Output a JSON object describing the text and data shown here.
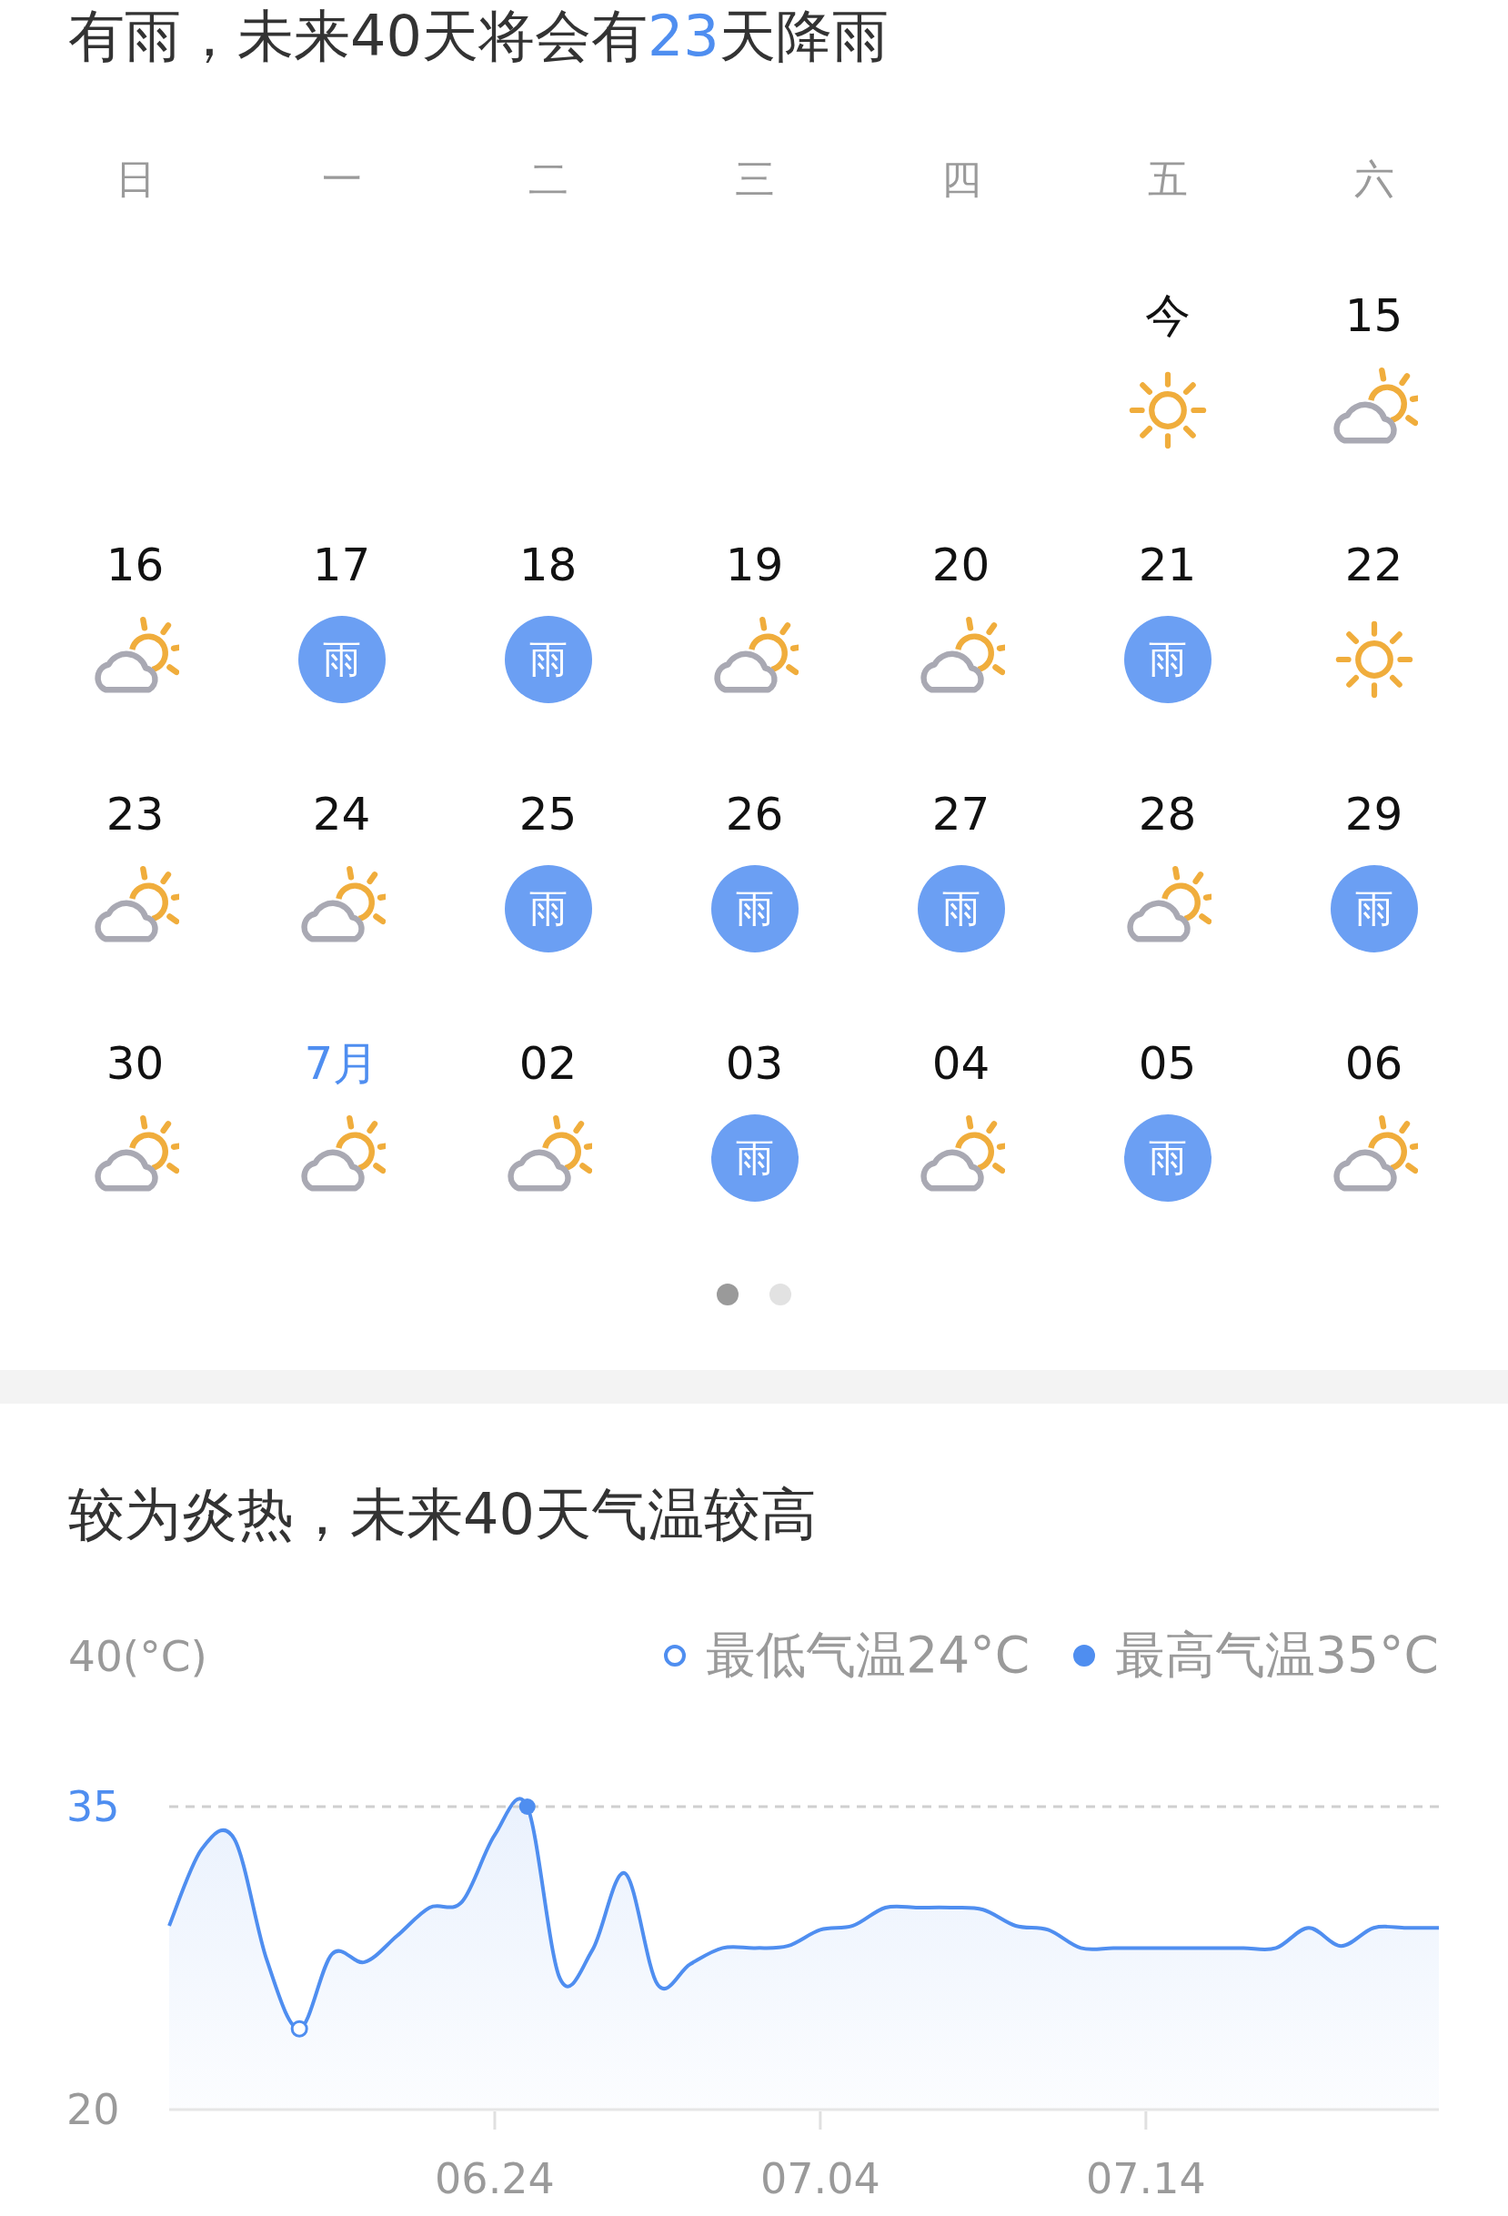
{
  "rain_summary": {
    "title": [
      {
        "text": "有雨，未来40天将会有",
        "highlight": false
      },
      {
        "text": "23",
        "highlight": true
      },
      {
        "text": "天降雨",
        "highlight": false
      }
    ],
    "weekdays": [
      "日",
      "一",
      "二",
      "三",
      "四",
      "五",
      "六"
    ],
    "weeks": [
      [
        {
          "date": "今",
          "month_start": false,
          "kind": "sunny"
        },
        {
          "date": "15",
          "month_start": false,
          "kind": "partly_cloudy"
        }
      ],
      [
        {
          "date": "16",
          "month_start": false,
          "kind": "partly_cloudy"
        },
        {
          "date": "17",
          "month_start": false,
          "kind": "rain",
          "label": "雨"
        },
        {
          "date": "18",
          "month_start": false,
          "kind": "rain",
          "label": "雨"
        },
        {
          "date": "19",
          "month_start": false,
          "kind": "partly_cloudy"
        },
        {
          "date": "20",
          "month_start": false,
          "kind": "partly_cloudy"
        },
        {
          "date": "21",
          "month_start": false,
          "kind": "rain",
          "label": "雨"
        },
        {
          "date": "22",
          "month_start": false,
          "kind": "sunny"
        }
      ],
      [
        {
          "date": "23",
          "month_start": false,
          "kind": "partly_cloudy"
        },
        {
          "date": "24",
          "month_start": false,
          "kind": "partly_cloudy"
        },
        {
          "date": "25",
          "month_start": false,
          "kind": "rain",
          "label": "雨"
        },
        {
          "date": "26",
          "month_start": false,
          "kind": "rain",
          "label": "雨"
        },
        {
          "date": "27",
          "month_start": false,
          "kind": "rain",
          "label": "雨"
        },
        {
          "date": "28",
          "month_start": false,
          "kind": "partly_cloudy"
        },
        {
          "date": "29",
          "month_start": false,
          "kind": "rain",
          "label": "雨"
        }
      ],
      [
        {
          "date": "30",
          "month_start": false,
          "kind": "partly_cloudy"
        },
        {
          "date": "7月",
          "month_start": true,
          "kind": "partly_cloudy"
        },
        {
          "date": "02",
          "month_start": false,
          "kind": "partly_cloudy"
        },
        {
          "date": "03",
          "month_start": false,
          "kind": "rain",
          "label": "雨"
        },
        {
          "date": "04",
          "month_start": false,
          "kind": "partly_cloudy"
        },
        {
          "date": "05",
          "month_start": false,
          "kind": "rain",
          "label": "雨"
        },
        {
          "date": "06",
          "month_start": false,
          "kind": "partly_cloudy"
        }
      ]
    ],
    "pager": [
      {
        "selected": true
      },
      {
        "selected": false
      }
    ]
  },
  "temperature": {
    "title": "较为炎热，未来40天气温较高",
    "legend": [
      {
        "kind": "hollow",
        "label": "最低气温24°C"
      },
      {
        "kind": "filled",
        "label": "最高气温35°C"
      }
    ],
    "chart_data": {
      "type": "area",
      "ylabel": "40(°C)",
      "categories": [
        null,
        null,
        null,
        null,
        null,
        null,
        null,
        null,
        null,
        null,
        "06.24",
        null,
        null,
        null,
        null,
        null,
        null,
        null,
        null,
        null,
        "07.04",
        null,
        null,
        null,
        null,
        null,
        null,
        null,
        null,
        null,
        "07.14",
        null,
        null,
        null,
        null,
        null,
        null,
        null,
        null,
        null
      ],
      "series": [
        {
          "color": "#4f8ef0",
          "values": [
            29.1,
            32.9,
            33.4,
            27.4,
            24,
            27.7,
            27.3,
            28.6,
            30,
            30.3,
            33.6,
            35,
            26.5,
            27.9,
            31.7,
            26.2,
            27.2,
            28,
            28,
            28.1,
            28.9,
            29.1,
            30,
            30,
            30,
            29.9,
            29.1,
            28.9,
            28,
            28,
            28,
            28,
            28,
            28,
            28,
            29,
            28.1,
            29,
            29,
            29
          ]
        }
      ],
      "ylim": [
        20,
        35
      ],
      "yticks": [
        {
          "value": 20,
          "label": "20"
        },
        {
          "value": 35,
          "label": "35"
        }
      ]
    }
  }
}
